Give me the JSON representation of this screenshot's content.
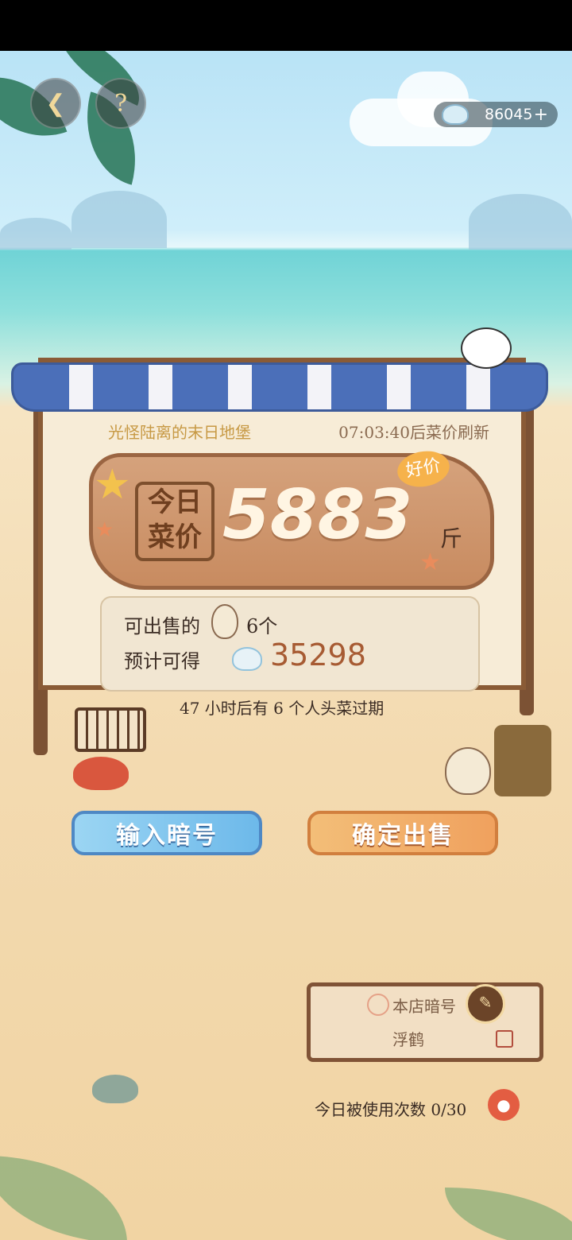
{
  "topbar": {
    "back_icon": "back-arrow-icon",
    "help_icon": "question-mark-icon",
    "help_label": "?",
    "currency_amount": "86045",
    "plus_label": "+"
  },
  "shop": {
    "name": "光怪陆离的末日地堡",
    "refresh_text": "07:03:40后菜价刷新",
    "today_label": [
      "今日",
      "菜价"
    ],
    "price": "5883",
    "unit": "斤",
    "badge": "好价"
  },
  "sale": {
    "sellable_label": "可出售的",
    "sellable_count": "6个",
    "expected_label": "预计可得",
    "expected_amount": "35298",
    "expire_text": "47 小时后有 6 个人头菜过期"
  },
  "buttons": {
    "input_code": "输入暗号",
    "confirm_sell": "确定出售"
  },
  "code_card": {
    "title": "本店暗号",
    "value": "浮鹤",
    "usage": "今日被使用次数 0/30"
  },
  "colors": {
    "awning_blue": "#4b6fb9",
    "price_text": "#fff5e3",
    "amount_text": "#a75b33"
  }
}
